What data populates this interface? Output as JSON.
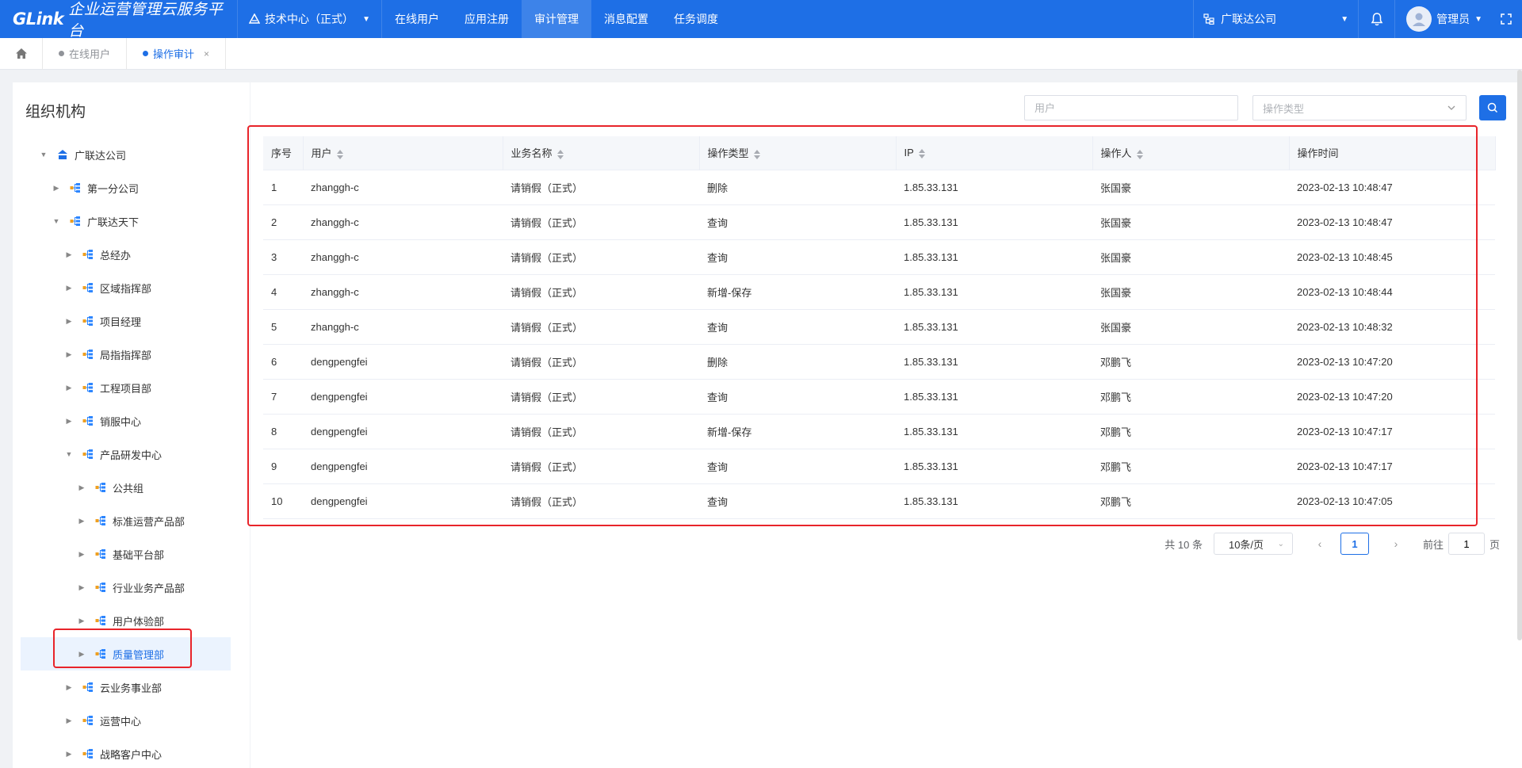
{
  "brand": {
    "logo": "GLink",
    "title": "企业运营管理云服务平台"
  },
  "center_selector": {
    "label": "技术中心（正式）"
  },
  "nav": {
    "items": [
      "在线用户",
      "应用注册",
      "审计管理",
      "消息配置",
      "任务调度"
    ],
    "active_index": 2
  },
  "company_selector": {
    "label": "广联达公司"
  },
  "user": {
    "name": "管理员"
  },
  "tabs": [
    {
      "label": "在线用户",
      "active": false
    },
    {
      "label": "操作审计",
      "active": true,
      "close": "×"
    }
  ],
  "org_panel": {
    "title": "组织机构",
    "nodes": [
      {
        "label": "广联达公司",
        "level": 0,
        "expanded": true,
        "root": true
      },
      {
        "label": "第一分公司",
        "level": 1,
        "expanded": false
      },
      {
        "label": "广联达天下",
        "level": 1,
        "expanded": true
      },
      {
        "label": "总经办",
        "level": 2,
        "expanded": false
      },
      {
        "label": "区域指挥部",
        "level": 2,
        "expanded": false
      },
      {
        "label": "项目经理",
        "level": 2,
        "expanded": false
      },
      {
        "label": "局指指挥部",
        "level": 2,
        "expanded": false
      },
      {
        "label": "工程项目部",
        "level": 2,
        "expanded": false
      },
      {
        "label": "销服中心",
        "level": 2,
        "expanded": false
      },
      {
        "label": "产品研发中心",
        "level": 2,
        "expanded": true
      },
      {
        "label": "公共组",
        "level": 3,
        "expanded": false
      },
      {
        "label": "标准运营产品部",
        "level": 3,
        "expanded": false
      },
      {
        "label": "基础平台部",
        "level": 3,
        "expanded": false
      },
      {
        "label": "行业业务产品部",
        "level": 3,
        "expanded": false
      },
      {
        "label": "用户体验部",
        "level": 3,
        "expanded": false
      },
      {
        "label": "质量管理部",
        "level": 3,
        "expanded": false,
        "selected": true
      },
      {
        "label": "云业务事业部",
        "level": 2,
        "expanded": false
      },
      {
        "label": "运营中心",
        "level": 2,
        "expanded": false
      },
      {
        "label": "战略客户中心",
        "level": 2,
        "expanded": false
      }
    ]
  },
  "filters": {
    "user_placeholder": "用户",
    "type_placeholder": "操作类型"
  },
  "table": {
    "columns": [
      {
        "label": "序号",
        "sortable": false
      },
      {
        "label": "用户",
        "sortable": true
      },
      {
        "label": "业务名称",
        "sortable": true
      },
      {
        "label": "操作类型",
        "sortable": true
      },
      {
        "label": "IP",
        "sortable": true
      },
      {
        "label": "操作人",
        "sortable": true
      },
      {
        "label": "操作时间",
        "sortable": false
      }
    ],
    "rows": [
      [
        "1",
        "zhanggh-c",
        "请销假（正式）",
        "删除",
        "1.85.33.131",
        "张国豪",
        "2023-02-13 10:48:47"
      ],
      [
        "2",
        "zhanggh-c",
        "请销假（正式）",
        "查询",
        "1.85.33.131",
        "张国豪",
        "2023-02-13 10:48:47"
      ],
      [
        "3",
        "zhanggh-c",
        "请销假（正式）",
        "查询",
        "1.85.33.131",
        "张国豪",
        "2023-02-13 10:48:45"
      ],
      [
        "4",
        "zhanggh-c",
        "请销假（正式）",
        "新增-保存",
        "1.85.33.131",
        "张国豪",
        "2023-02-13 10:48:44"
      ],
      [
        "5",
        "zhanggh-c",
        "请销假（正式）",
        "查询",
        "1.85.33.131",
        "张国豪",
        "2023-02-13 10:48:32"
      ],
      [
        "6",
        "dengpengfei",
        "请销假（正式）",
        "删除",
        "1.85.33.131",
        "邓鹏飞",
        "2023-02-13 10:47:20"
      ],
      [
        "7",
        "dengpengfei",
        "请销假（正式）",
        "查询",
        "1.85.33.131",
        "邓鹏飞",
        "2023-02-13 10:47:20"
      ],
      [
        "8",
        "dengpengfei",
        "请销假（正式）",
        "新增-保存",
        "1.85.33.131",
        "邓鹏飞",
        "2023-02-13 10:47:17"
      ],
      [
        "9",
        "dengpengfei",
        "请销假（正式）",
        "查询",
        "1.85.33.131",
        "邓鹏飞",
        "2023-02-13 10:47:17"
      ],
      [
        "10",
        "dengpengfei",
        "请销假（正式）",
        "查询",
        "1.85.33.131",
        "邓鹏飞",
        "2023-02-13 10:47:05"
      ]
    ]
  },
  "pagination": {
    "total": "共 10 条",
    "page_size": "10条/页",
    "current": "1",
    "goto_label": "前往",
    "goto_value": "1",
    "page_suffix": "页"
  },
  "colors": {
    "primary": "#1e6fe6",
    "highlight": "#e8242a",
    "selected_bg": "#ebf3fe"
  }
}
